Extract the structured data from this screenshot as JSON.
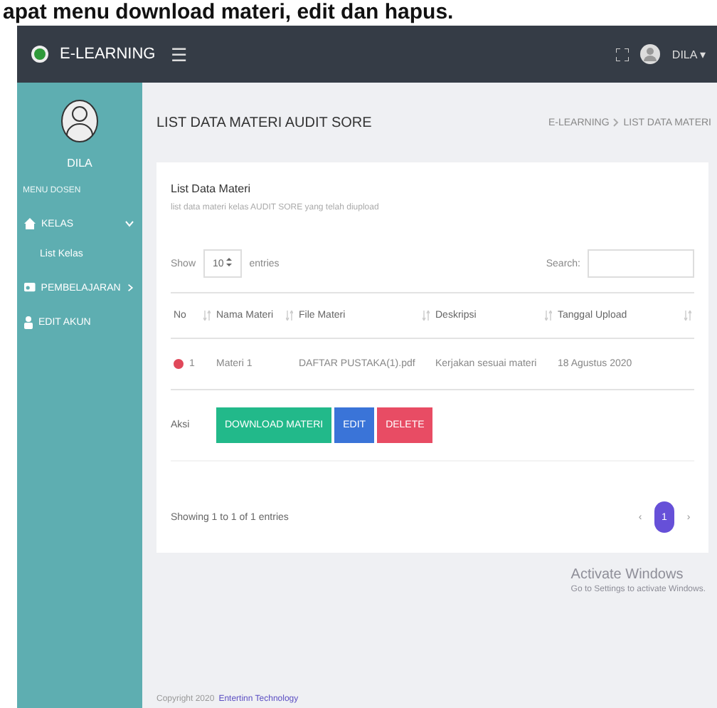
{
  "caption": "apat menu download materi, edit dan hapus.",
  "topbar": {
    "brand": "E-LEARNING",
    "menu_icon": "☰",
    "user": "DILA",
    "user_caret": "▾"
  },
  "sidebar": {
    "user": "DILA",
    "section": "MENU DOSEN",
    "items": [
      {
        "label": "KELAS",
        "expanded": true,
        "children": [
          {
            "label": "List Kelas"
          }
        ]
      },
      {
        "label": "PEMBELAJARAN",
        "expanded": false
      },
      {
        "label": "EDIT AKUN"
      }
    ]
  },
  "page": {
    "title": "LIST DATA MATERI AUDIT SORE",
    "breadcrumb": [
      "E-LEARNING",
      "LIST DATA MATERI"
    ]
  },
  "card": {
    "title": "List Data Materi",
    "subtitle": "list data materi kelas AUDIT SORE yang telah diupload",
    "show_label": "Show",
    "page_size": "10",
    "entries_label": "entries",
    "search_label": "Search:",
    "columns": [
      "No",
      "Nama Materi",
      "File Materi",
      "Deskripsi",
      "Tanggal Upload"
    ],
    "rows": [
      {
        "cells": [
          "1",
          "Materi 1",
          "DAFTAR PUSTAKA(1).pdf",
          "Kerjakan sesuai materi",
          "18 Agustus 2020"
        ],
        "expanded": true
      }
    ],
    "action_label": "Aksi",
    "actions": [
      {
        "label": "DOWNLOAD MATERI",
        "kind": "success"
      },
      {
        "label": "EDIT",
        "kind": "primary"
      },
      {
        "label": "DELETE",
        "kind": "danger"
      }
    ],
    "info": "Showing 1 to 1 of 1 entries",
    "pagination": [
      {
        "label": "‹",
        "selected": false
      },
      {
        "label": "1",
        "selected": true
      },
      {
        "label": "›",
        "selected": false
      }
    ]
  },
  "watermark": {
    "title": "Activate Windows",
    "text": "Go to Settings to activate Windows."
  },
  "footer": {
    "text": "Copyright 2020",
    "link": "Entertinn Technology"
  }
}
